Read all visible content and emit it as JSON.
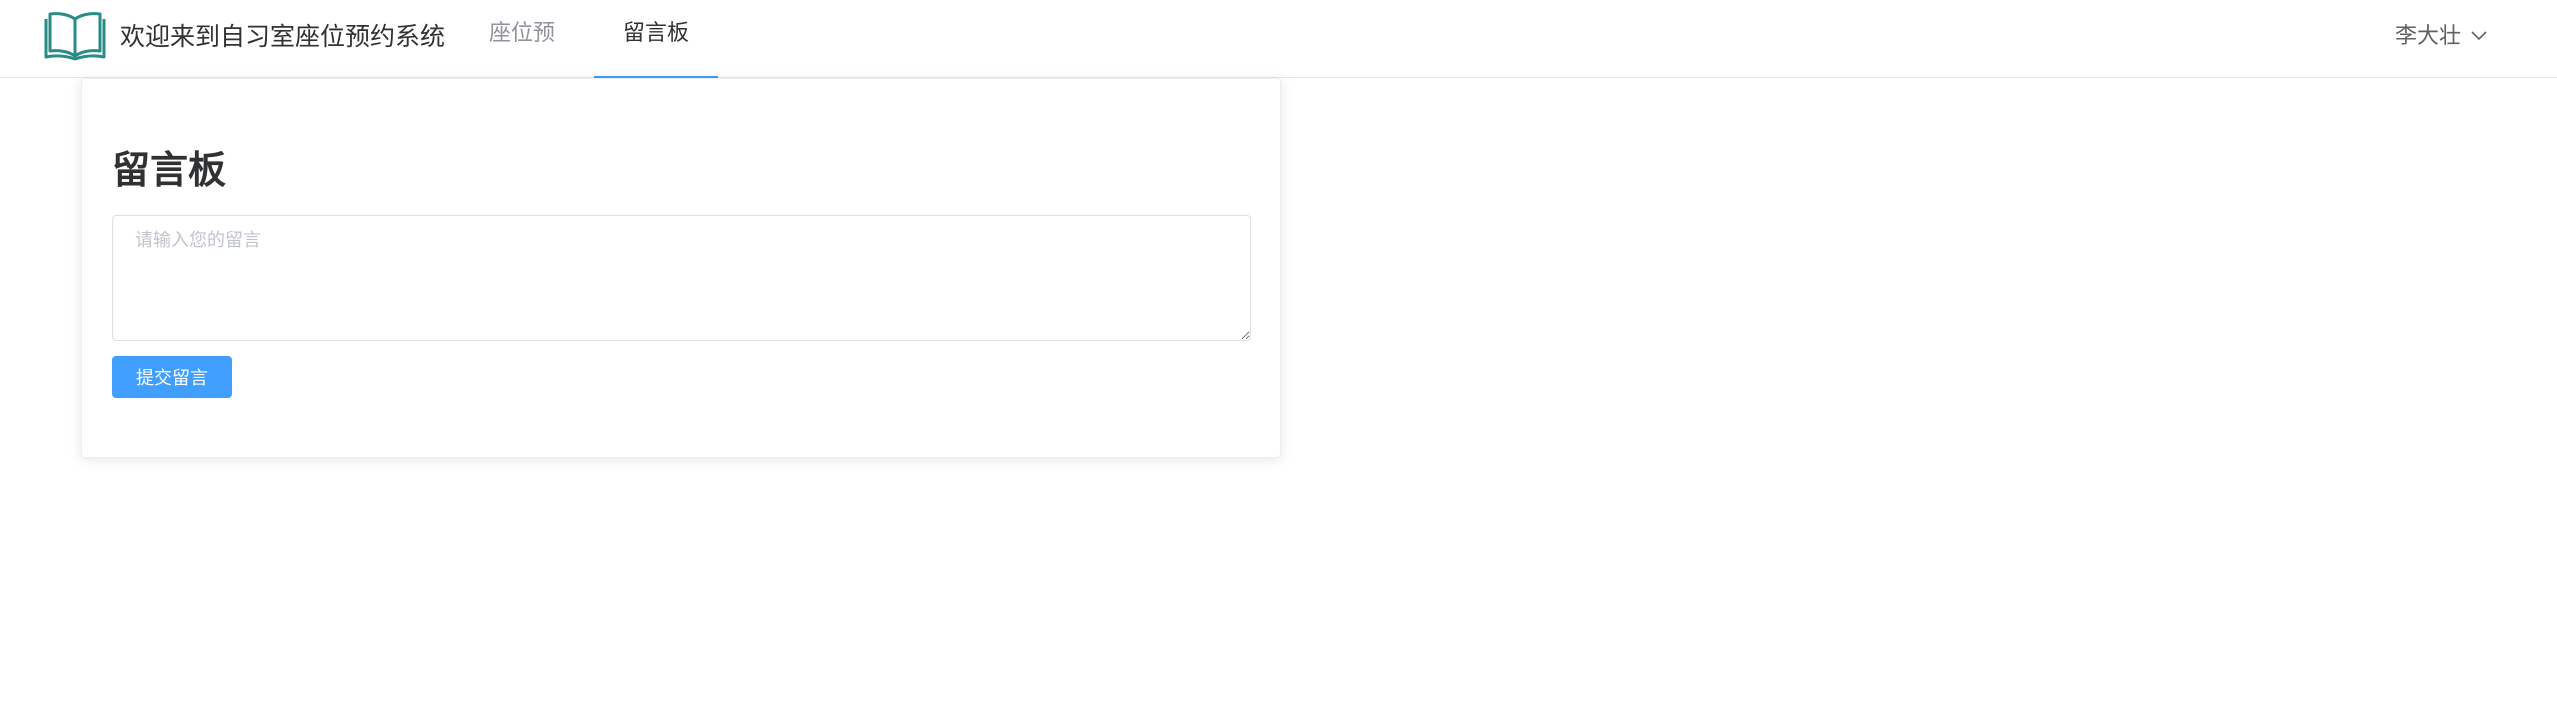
{
  "header": {
    "app_title": "欢迎来到自习室座位预约系统",
    "logo_icon": "open-book-icon",
    "nav": [
      {
        "label": "座位预约",
        "active": false
      },
      {
        "label": "留言板",
        "active": true
      }
    ],
    "user": {
      "name": "李大壮",
      "dropdown_icon": "chevron-down-icon"
    }
  },
  "colors": {
    "accent": "#409eff",
    "logo": "#2a8c87"
  },
  "board": {
    "title": "留言板",
    "message_placeholder": "请输入您的留言",
    "message_value": "",
    "submit_label": "提交留言"
  }
}
